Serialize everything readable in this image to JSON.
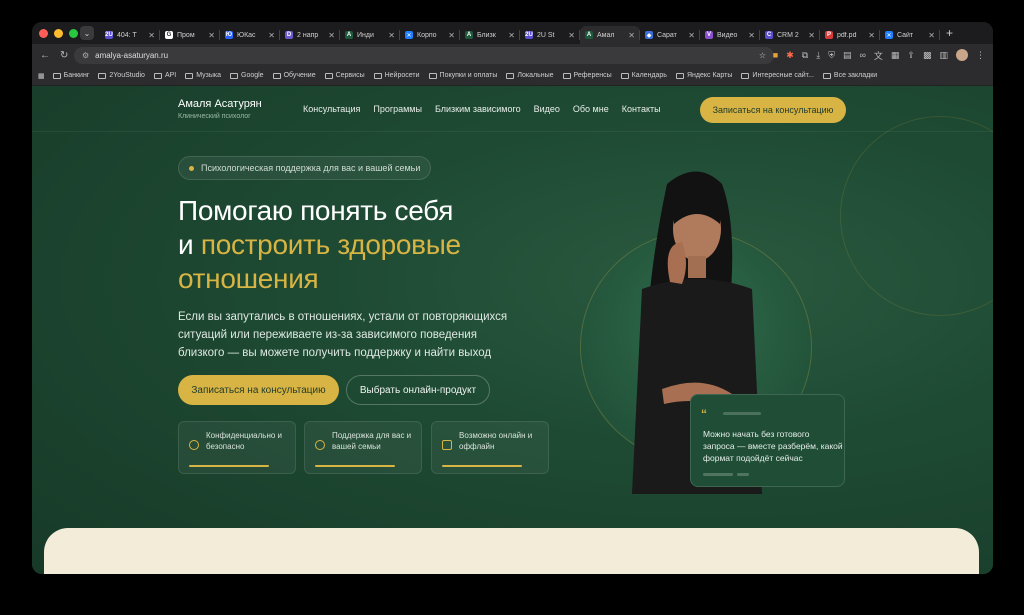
{
  "browser": {
    "tabs": [
      {
        "title": "404: T",
        "color": "#5a4fcf",
        "glyph": "2U"
      },
      {
        "title": "Пром",
        "color": "#ffffff",
        "glyph": "G"
      },
      {
        "title": "ЮКас",
        "color": "#2b63ff",
        "glyph": "Ю"
      },
      {
        "title": "2 напр",
        "color": "#6a5acd",
        "glyph": "D"
      },
      {
        "title": "Инди",
        "color": "#1f5a3c",
        "glyph": "A"
      },
      {
        "title": "Корпо",
        "color": "#1f7dff",
        "glyph": "✕"
      },
      {
        "title": "Близк",
        "color": "#1f5a3c",
        "glyph": "A"
      },
      {
        "title": "2U St",
        "color": "#5a4fcf",
        "glyph": "2U"
      },
      {
        "title": "Амал",
        "color": "#1f5a3c",
        "glyph": "A"
      },
      {
        "title": "Сарат",
        "color": "#3a6fd8",
        "glyph": "◆"
      },
      {
        "title": "Видео",
        "color": "#8a4fcf",
        "glyph": "V"
      },
      {
        "title": "CRM 2",
        "color": "#5a4fcf",
        "glyph": "C"
      },
      {
        "title": "pdf.pd",
        "color": "#d83a3a",
        "glyph": "P"
      },
      {
        "title": "Сайт",
        "color": "#1f7dff",
        "glyph": "✕"
      }
    ],
    "active_tab_index": 8,
    "url": "amalya-asaturyan.ru",
    "bookmarks": [
      "Банкинг",
      "2YouStudio",
      "API",
      "Музыка",
      "Google",
      "Обучение",
      "Сервисы",
      "Нейросети",
      "Покупки и оплаты",
      "Локальные",
      "Референсы",
      "Календарь",
      "Яндекс Карты",
      "Интересные сайт...",
      "Все закладки"
    ]
  },
  "site": {
    "brand": "Амаля Асатурян",
    "brand_sub": "Клинический психолог",
    "menu": [
      "Консультация",
      "Программы",
      "Близким зависимого",
      "Видео",
      "Обо мне",
      "Контакты"
    ],
    "cta_top": "Записаться на консультацию",
    "pill": "Психологическая поддержка для вас и вашей семьи",
    "h1_line1": "Помогаю понять себя",
    "h1_line2_white": "и ",
    "h1_line2_gold": "построить здоровые",
    "h1_line3": "отношения",
    "lead": "Если вы запутались в отношениях, устали от повторяющихся ситуаций или переживаете из-за зависимого поведения близкого — вы можете получить поддержку и найти выход",
    "btn_primary": "Записаться на консультацию",
    "btn_secondary": "Выбрать онлайн-продукт",
    "features": [
      {
        "text": "Конфиденциально и безопасно"
      },
      {
        "text": "Поддержка для вас и вашей семьи"
      },
      {
        "text": "Возможно онлайн и оффлайн"
      }
    ],
    "quote_mark": "“",
    "quote": "Можно начать без готового запроса — вместе разберём, какой формат подойдёт сейчас",
    "accent": "#d8b444"
  }
}
